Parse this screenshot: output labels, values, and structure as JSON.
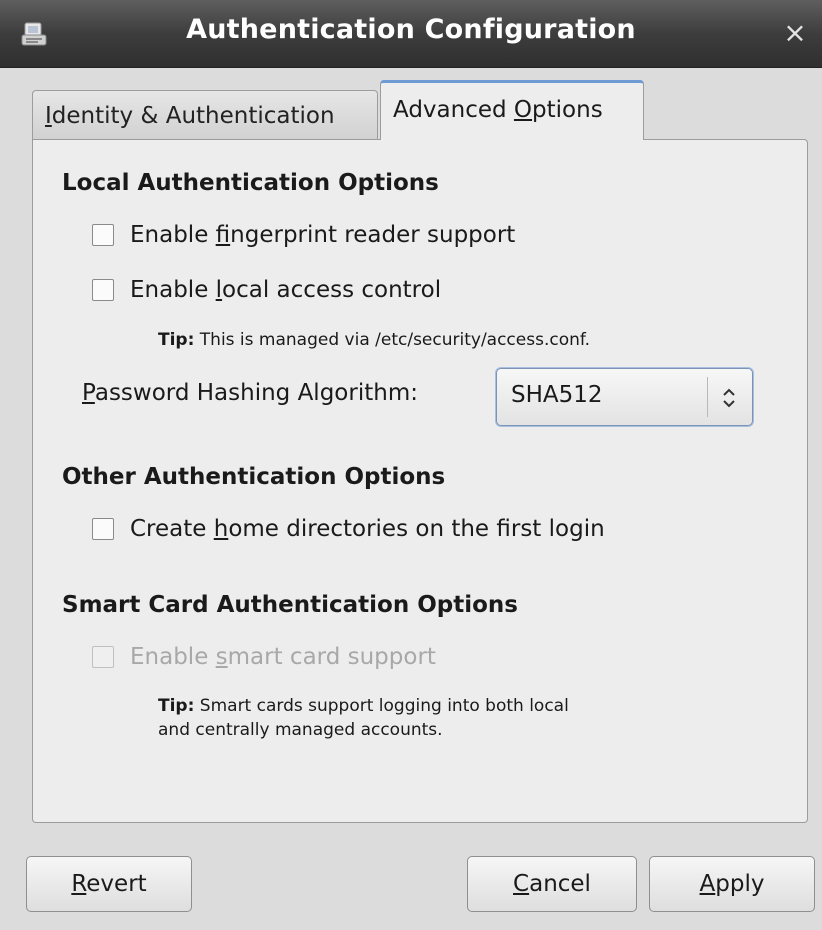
{
  "window": {
    "title": "Authentication Configuration",
    "close_glyph": "×",
    "icon": "app-icon"
  },
  "tabs": [
    {
      "label_pre": "",
      "label_key": "I",
      "label_post": "dentity & Authentication",
      "active": false
    },
    {
      "label_pre": "Advanced ",
      "label_key": "O",
      "label_post": "ptions",
      "active": true
    }
  ],
  "local_auth": {
    "title": "Local Authentication Options",
    "fingerprint": {
      "pre": "Enable ",
      "key": "f",
      "post": "ingerprint reader support",
      "checked": false
    },
    "local_access": {
      "pre": "Enable ",
      "key": "l",
      "post": "ocal access control",
      "checked": false
    },
    "tip": {
      "label": "Tip:",
      "text": " This is managed via /etc/security/access.conf."
    },
    "hashing": {
      "label_key": "P",
      "label_post": "assword Hashing Algorithm:",
      "value": "SHA512"
    }
  },
  "other_auth": {
    "title": "Other Authentication Options",
    "home_dirs": {
      "pre": "Create ",
      "key": "h",
      "post": "ome directories on the first login",
      "checked": false
    }
  },
  "smart_card": {
    "title": "Smart Card Authentication Options",
    "enable": {
      "pre": "Enable ",
      "key": "s",
      "post": "mart card support",
      "checked": false,
      "disabled": true
    },
    "tip": {
      "label": "Tip:",
      "line1": " Smart cards support logging into both local",
      "line2": "and centrally managed accounts."
    }
  },
  "buttons": {
    "revert": {
      "key": "R",
      "post": "evert"
    },
    "cancel": {
      "key": "C",
      "post": "ancel"
    },
    "apply": {
      "key": "A",
      "post": "pply"
    }
  },
  "colors": {
    "titlebar": "#3d3d3d",
    "panel": "#ededed",
    "active_tab_accent": "#6f9ad3",
    "disabled_text": "#a8a8a8"
  }
}
